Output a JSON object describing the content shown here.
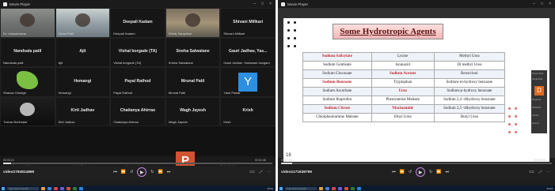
{
  "window": {
    "title_left": "Movie Player",
    "title_right": "Movie Player",
    "min": "–",
    "max": "□",
    "close": "×"
  },
  "meeting": {
    "tiles": [
      {
        "label": "Dr. Udaysinhwar",
        "center": "",
        "kind": "video1"
      },
      {
        "label": "Dipan Patil",
        "center": "",
        "kind": "video2"
      },
      {
        "label": "Deepali Kadam",
        "center": "Deepali Kadam",
        "kind": "blank"
      },
      {
        "label": "Dhiraj Sangvikar",
        "center": "",
        "kind": "video3"
      },
      {
        "label": "Shivani Millkari",
        "center": "Shivani Millkari",
        "kind": "blank"
      },
      {
        "label": "Nandsala patil",
        "center": "Nandsala patil",
        "kind": "blank"
      },
      {
        "label": "Ajit",
        "center": "Ajit",
        "kind": "blank"
      },
      {
        "label": "Vishal borgade (TA)",
        "center": "Vishal borgade (TA)",
        "kind": "blank"
      },
      {
        "label": "Sneha Salwalane",
        "center": "Sneha Salwalane",
        "kind": "blank"
      },
      {
        "label": "Gauri Jadhav, Yashwant Jangam",
        "center": "Gauri Jadhav, Yas...",
        "kind": "blank"
      },
      {
        "label": "Shanaz Ghadge",
        "center": "",
        "kind": "logo"
      },
      {
        "label": "Hemangi",
        "center": "Hemangi",
        "kind": "blank"
      },
      {
        "label": "Payal Rathod",
        "center": "Payal Rathod",
        "kind": "blank"
      },
      {
        "label": "Mrunal Patil",
        "center": "Mrunal Patil",
        "kind": "blank"
      },
      {
        "label": "Yash Pawar",
        "center": "",
        "kind": "avatar"
      },
      {
        "label": "Tushar Borkhade",
        "center": "",
        "kind": "video4"
      },
      {
        "label": "Kirti Jadhav",
        "center": "Kirti Jadhav",
        "kind": "blank"
      },
      {
        "label": "Chaitanya Ahirrao",
        "center": "Chaitanya Ahirrao",
        "kind": "blank"
      },
      {
        "label": "Wagh Jayesh",
        "center": "Wagh Jayesh",
        "kind": "blank"
      },
      {
        "label": "Krish",
        "center": "Krish",
        "kind": "blank"
      }
    ],
    "avatar_letter": "Y",
    "strip_names": [
      "Pranav V Shinde",
      "Yash Rathod",
      "Sneha Jhinjhangal...",
      "Rohit Shibhavane"
    ],
    "ppt_letter": "P"
  },
  "player_left": {
    "video_name": "video2784814869",
    "time_start": "00:03:21",
    "time_end": "02:01:46",
    "progress_pct": 0.03
  },
  "player_right": {
    "video_name": "video1171638799",
    "time_start": "00:07:51",
    "time_end": "03:31:36",
    "progress_pct": 0.04
  },
  "controls": {
    "prev": "⏮",
    "back": "⏪",
    "rew": "↺",
    "play": "▶",
    "fwd": "↻",
    "skip": "⏩",
    "next": "⏭",
    "cc": "CC",
    "fullscreen": "⤢",
    "more": "⋯"
  },
  "taskbar": {
    "search_placeholder": "Type here to search",
    "clock_left": "23:31",
    "clock_right": "23:34"
  },
  "slide": {
    "title": "Some Hydrotropic Agents",
    "slide_number": "18",
    "rows": [
      [
        {
          "t": "Sodium Salicylate",
          "red": true
        },
        {
          "t": "Lysine",
          "red": false
        },
        {
          "t": "Methyl Urea",
          "red": false
        }
      ],
      [
        {
          "t": "Sodium Gentisate",
          "red": false
        },
        {
          "t": "Isoniazid",
          "red": false
        },
        {
          "t": "Di methyl Urea",
          "red": false
        }
      ],
      [
        {
          "t": "Sodium Gluconate",
          "red": false
        },
        {
          "t": "Sodium Acetate",
          "red": true
        },
        {
          "t": "Resorcinol",
          "red": false
        }
      ],
      [
        {
          "t": "Sodium Benzoate",
          "red": true
        },
        {
          "t": "Tryptophan",
          "red": false
        },
        {
          "t": "Sodium-m-hydroxy benzoate",
          "red": false
        }
      ],
      [
        {
          "t": "Sodium Ascorbate",
          "red": false
        },
        {
          "t": "Urea",
          "red": true
        },
        {
          "t": "Sodium-p-hydroxy benzoate",
          "red": false
        }
      ],
      [
        {
          "t": "Sodium Ibuprofen",
          "red": false
        },
        {
          "t": "Pheniramine Maleate",
          "red": false
        },
        {
          "t": "Sodium 2,4 -dihydroxy benzoate",
          "red": false
        }
      ],
      [
        {
          "t": "Sodium Citrate",
          "red": true
        },
        {
          "t": "Niacinamide",
          "red": true
        },
        {
          "t": "Sodium 2,5 -dihydroxy benzoate",
          "red": false
        }
      ],
      [
        {
          "t": "Chlolpheniramine Maleate",
          "red": false
        },
        {
          "t": "Ethyl Urea",
          "red": false
        },
        {
          "t": "Butyl Urea",
          "red": false
        }
      ]
    ],
    "side_avatar": "D",
    "side_names": [
      "Priyam Shah",
      "Tanuja Patil",
      "Dnyanesh",
      "Harshal R",
      "Vishal L",
      "Sumit K"
    ]
  },
  "colors": {
    "accent_play": "#c58be8",
    "title_text": "#5b1515",
    "red_text": "#c0262b",
    "avatar_blue": "#2d8fe0",
    "ppt_orange": "#d35230"
  }
}
